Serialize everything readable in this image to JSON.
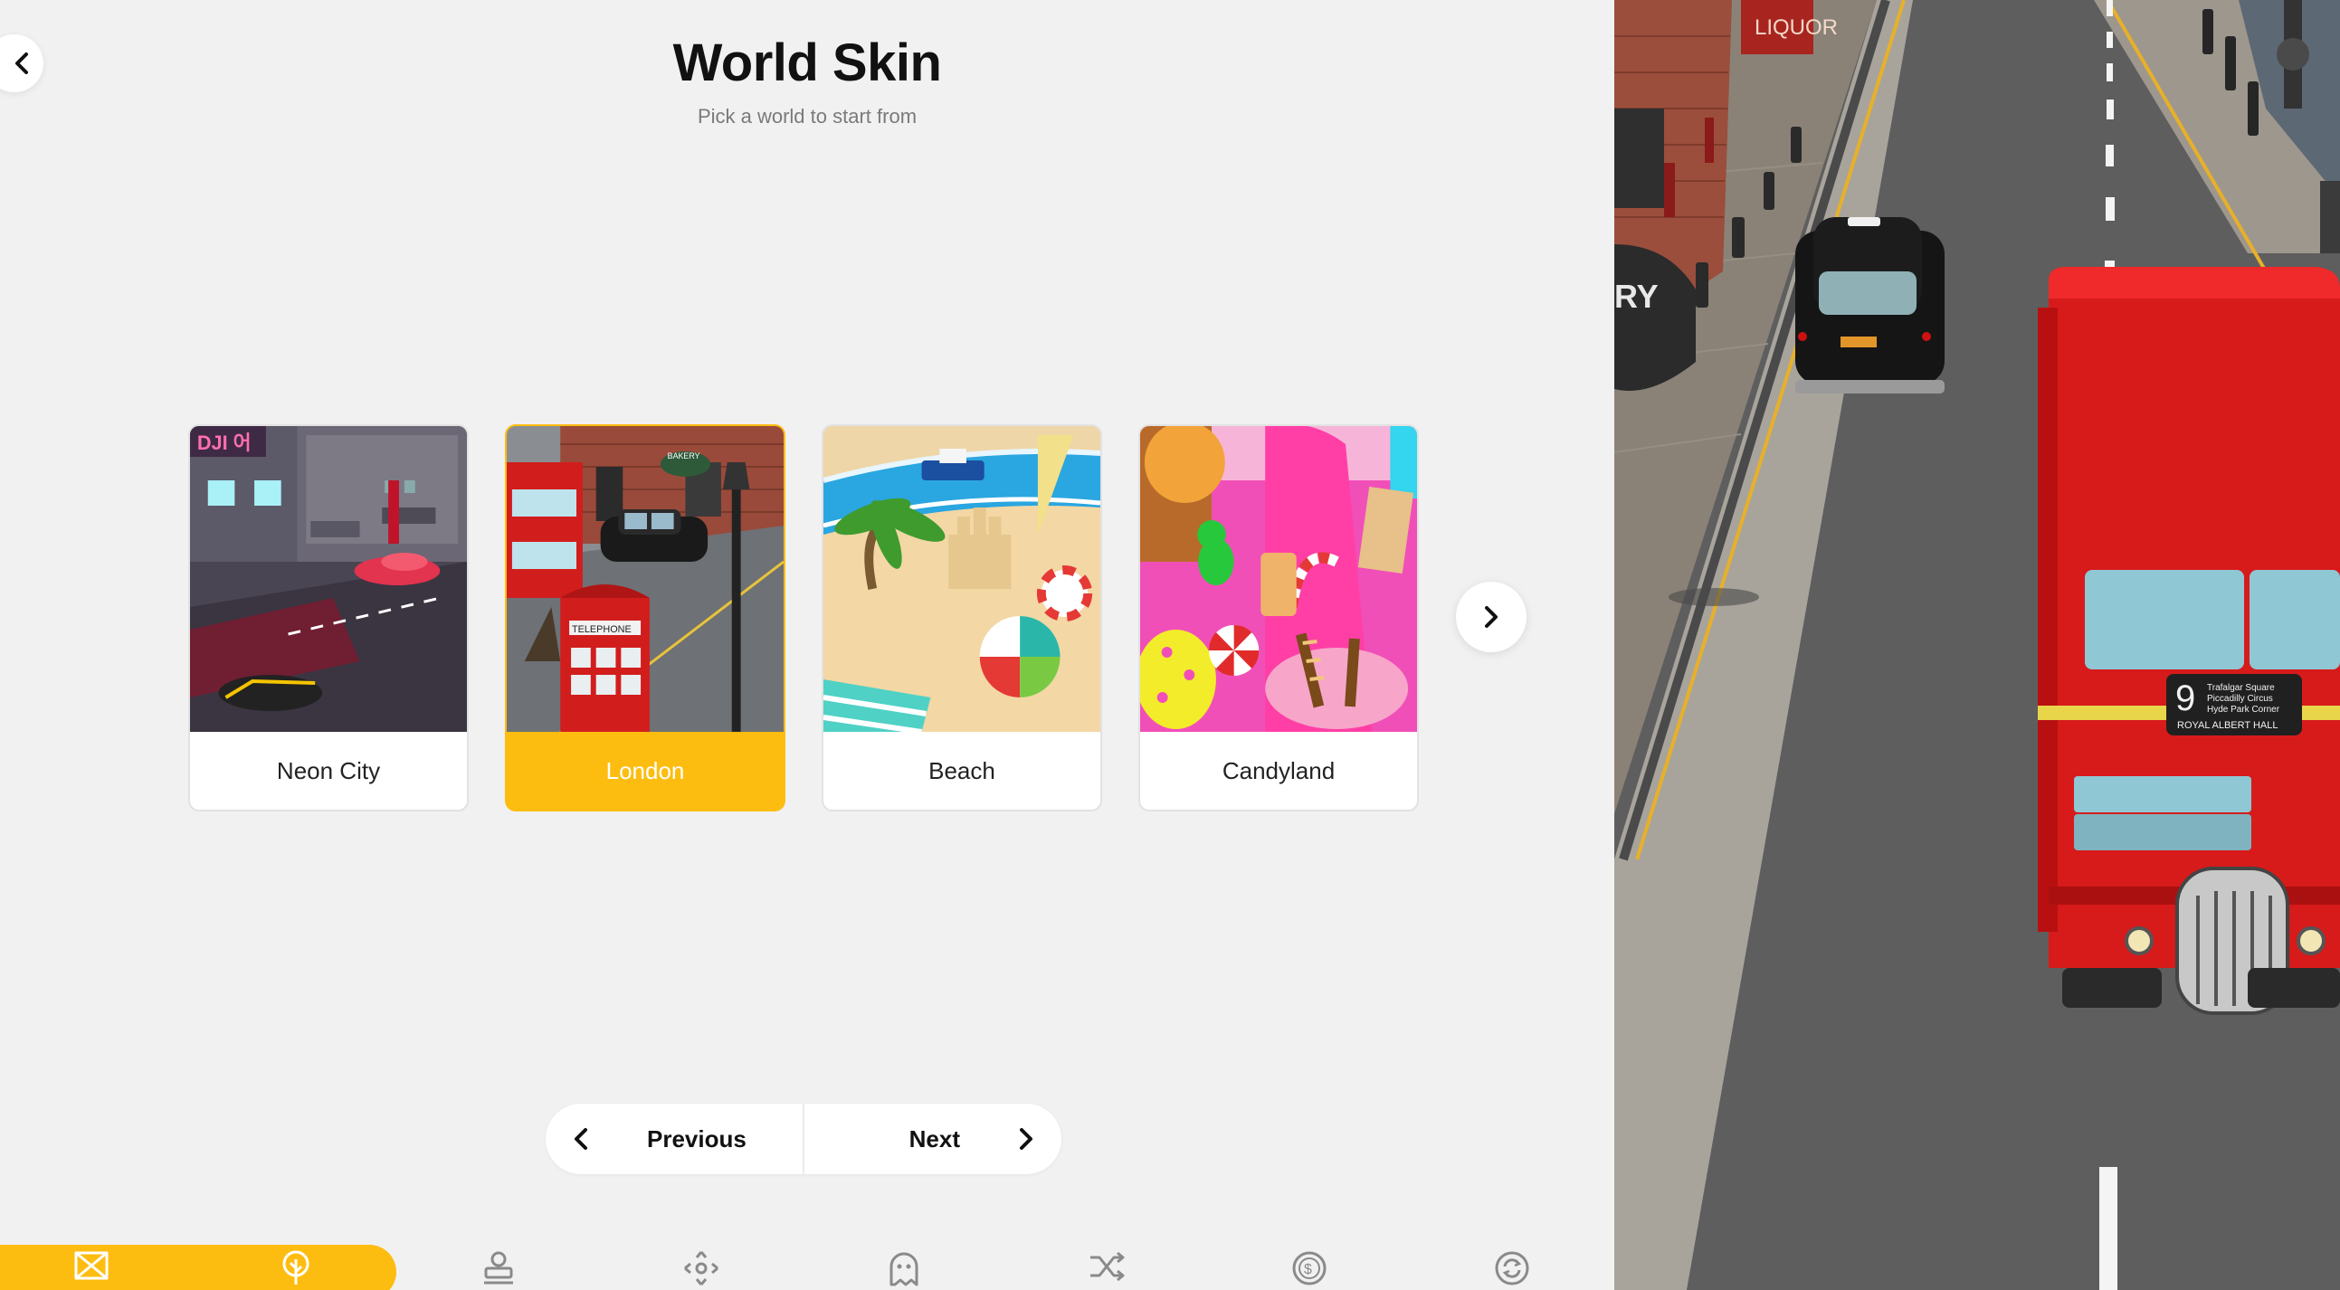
{
  "header": {
    "title": "World Skin",
    "subtitle": "Pick a world to start from"
  },
  "worlds": [
    {
      "label": "Neon City",
      "selected": false,
      "thumb_sign": "DJI 어"
    },
    {
      "label": "London",
      "selected": true,
      "thumb_sign": "BAKERY",
      "thumb_booth": "TELEPHONE"
    },
    {
      "label": "Beach",
      "selected": false
    },
    {
      "label": "Candyland",
      "selected": false
    }
  ],
  "pager": {
    "previous_label": "Previous",
    "next_label": "Next"
  },
  "bottom_nav": {
    "active_index": 1,
    "items": [
      {
        "icon": "bowtie-icon"
      },
      {
        "icon": "tree-icon"
      },
      {
        "icon": "stamp-icon"
      },
      {
        "icon": "move-arrows-icon"
      },
      {
        "icon": "ghost-icon"
      },
      {
        "icon": "shuffle-icon"
      },
      {
        "icon": "coin-icon"
      },
      {
        "icon": "refresh-icon"
      }
    ]
  },
  "preview": {
    "shop_sign": "LIQUOR",
    "wall_sign": "RY",
    "bus_route_number": "9",
    "bus_destination_lines": [
      "Trafalgar Square",
      "Piccadilly Circus",
      "Hyde Park Corner"
    ],
    "bus_destination_footer": "ROYAL ALBERT HALL"
  },
  "colors": {
    "accent": "#fdbd10",
    "background": "#f1f1f1",
    "card_border": "#e2e2e2",
    "bus_red": "#d71a1a",
    "road": "#5a5a5a"
  }
}
